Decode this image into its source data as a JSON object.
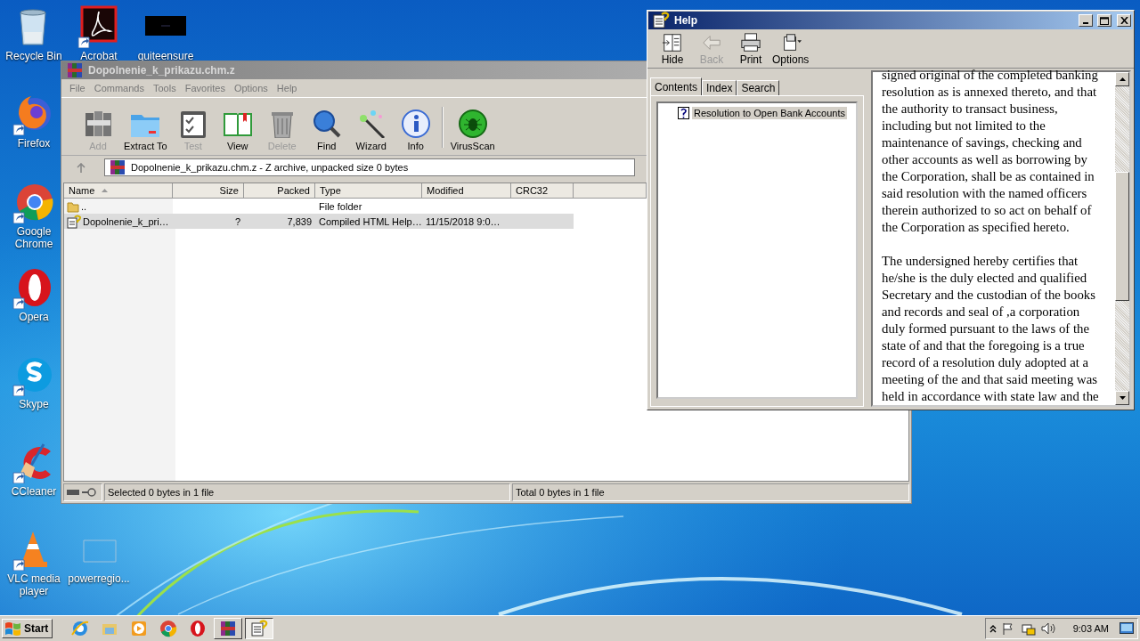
{
  "desktop_icons": [
    {
      "label": "Recycle Bin",
      "kind": "recycle",
      "shortcut": false
    },
    {
      "label": "Acrobat",
      "kind": "acrobat",
      "shortcut": true
    },
    {
      "label": "quiteensure",
      "kind": "dark",
      "shortcut": false
    },
    {
      "label": "Firefox",
      "kind": "firefox",
      "shortcut": true
    },
    {
      "label": "Google Chrome",
      "kind": "chrome",
      "shortcut": true
    },
    {
      "label": "Opera",
      "kind": "opera",
      "shortcut": true
    },
    {
      "label": "Skype",
      "kind": "skype",
      "shortcut": true
    },
    {
      "label": "CCleaner",
      "kind": "ccleaner",
      "shortcut": true
    },
    {
      "label": "VLC media player",
      "kind": "vlc",
      "shortcut": true
    },
    {
      "label": "powerregio...",
      "kind": "blank",
      "shortcut": false
    }
  ],
  "archiver": {
    "title": "Dopolnenie_k_prikazu.chm.z",
    "menu": [
      "File",
      "Commands",
      "Tools",
      "Favorites",
      "Options",
      "Help"
    ],
    "toolbar": [
      {
        "label": "Add",
        "kind": "add",
        "disabled": true
      },
      {
        "label": "Extract To",
        "kind": "extract",
        "disabled": false
      },
      {
        "label": "Test",
        "kind": "test",
        "disabled": true
      },
      {
        "label": "View",
        "kind": "view",
        "disabled": false
      },
      {
        "label": "Delete",
        "kind": "delete",
        "disabled": true
      },
      {
        "label": "Find",
        "kind": "find",
        "disabled": false
      },
      {
        "label": "Wizard",
        "kind": "wizard",
        "disabled": false
      },
      {
        "label": "Info",
        "kind": "info",
        "disabled": false
      },
      {
        "label": "VirusScan",
        "kind": "virus",
        "disabled": false
      }
    ],
    "address": "Dopolnenie_k_prikazu.chm.z - Z archive, unpacked size 0 bytes",
    "columns": [
      "Name",
      "Size",
      "Packed",
      "Type",
      "Modified",
      "CRC32"
    ],
    "rows": [
      {
        "kind": "folder",
        "selected": false,
        "cells": [
          "..",
          "",
          "",
          "File folder",
          "",
          ""
        ]
      },
      {
        "kind": "help-file",
        "selected": true,
        "cells": [
          "Dopolnenie_k_pri…",
          "?",
          "7,839",
          "Compiled HTML Help…",
          "11/15/2018 9:0…",
          ""
        ]
      }
    ],
    "status": [
      "Selected 0 bytes in 1 file",
      "Total 0 bytes in 1 file"
    ]
  },
  "help": {
    "title": "Help",
    "toolbar": [
      {
        "label": "Hide",
        "kind": "hide",
        "disabled": false
      },
      {
        "label": "Back",
        "kind": "back",
        "disabled": true
      },
      {
        "label": "Print",
        "kind": "print",
        "disabled": false
      },
      {
        "label": "Options",
        "kind": "options",
        "disabled": false
      }
    ],
    "tabs": [
      {
        "label": "Contents",
        "selected": true
      },
      {
        "label": "Index",
        "selected": false
      },
      {
        "label": "Search",
        "selected": false
      }
    ],
    "tree": [
      {
        "label": "Resolution to Open Bank Accounts",
        "selected": true
      }
    ],
    "paragraphs": [
      "signed original of the completed banking resolution as is annexed thereto, and that the authority to transact business, including but not limited to the maintenance of savings, checking and other accounts as well as borrowing by the Corporation, shall be as contained in said resolution with the named officers therein authorized to so act on behalf of the Corporation as specified hereto.",
      "The undersigned hereby certifies that he/she is the duly elected and qualified Secretary and the custodian of the books and records and seal of ,a corporation duly formed pursuant to the laws of the state of and that the foregoing is a true record of a resolution duly adopted at a meeting of the and that said meeting was held in accordance with state law and the"
    ]
  },
  "taskbar": {
    "start": "Start",
    "apps": [
      {
        "kind": "ie",
        "active": false
      },
      {
        "kind": "explorer",
        "active": false
      },
      {
        "kind": "media",
        "active": false
      },
      {
        "kind": "chrome",
        "active": false
      },
      {
        "kind": "opera",
        "active": false
      },
      {
        "kind": "winrar",
        "active": false
      },
      {
        "kind": "help",
        "active": true
      }
    ],
    "clock": "9:03 AM"
  }
}
